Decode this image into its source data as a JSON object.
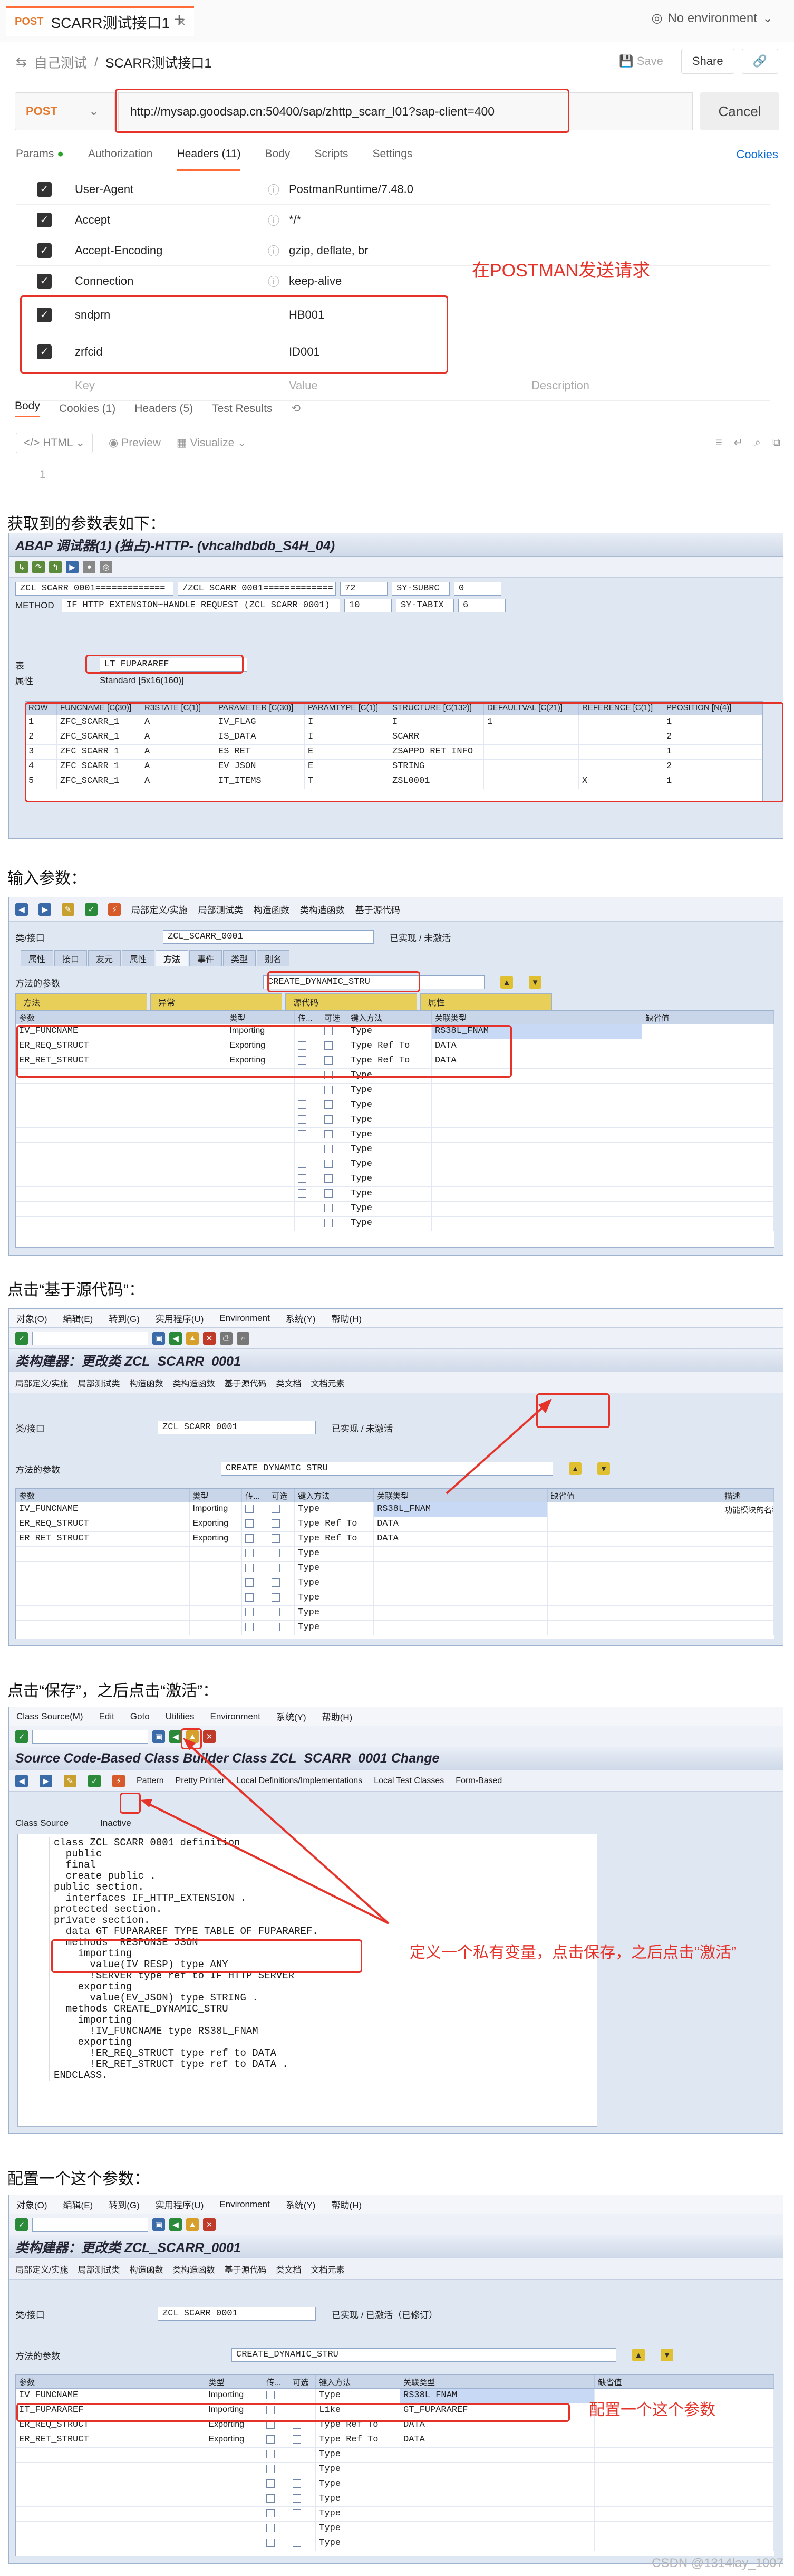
{
  "postman": {
    "tab_method": "POST",
    "tab_title": "SCARR测试接口1",
    "env_label": "No environment",
    "crumb_parent": "自己测试",
    "crumb_title": "SCARR测试接口1",
    "save_label": "Save",
    "share_label": "Share",
    "method": "POST",
    "url": "http://mysap.goodsap.cn:50400/sap/zhttp_scarr_l01?sap-client=400",
    "cancel_label": "Cancel",
    "req_tabs": [
      "Params",
      "Authorization",
      "Headers (11)",
      "Body",
      "Scripts",
      "Settings"
    ],
    "cookies_label": "Cookies",
    "headers": [
      {
        "key": "User-Agent",
        "value": "PostmanRuntime/7.48.0"
      },
      {
        "key": "Accept",
        "value": "*/*"
      },
      {
        "key": "Accept-Encoding",
        "value": "gzip, deflate, br"
      },
      {
        "key": "Connection",
        "value": "keep-alive"
      },
      {
        "key": "sndprn",
        "value": "HB001"
      },
      {
        "key": "zrfcid",
        "value": "ID001"
      }
    ],
    "placeholder": {
      "key": "Key",
      "value": "Value",
      "desc": "Description"
    },
    "annotation": "在POSTMAN发送请求",
    "resp_tabs": [
      "Body",
      "Cookies (1)",
      "Headers (5)",
      "Test Results"
    ],
    "resp_tools": [
      "HTML",
      "Preview",
      "Visualize"
    ],
    "line_number": "1"
  },
  "captions": {
    "c1": "获取到的参数表如下：",
    "c2": "输入参数：",
    "c3": "点击“基于源代码”：",
    "c4": "点击“保存”，之后点击“激活”：",
    "c5": "配置一个这个参数："
  },
  "debugger": {
    "title": "ABAP 调试器(1) (独占)-HTTP- (vhcalhdbdb_S4H_04)",
    "var1": "ZCL_SCARR_0001=============",
    "var2": "/ZCL_SCARR_0001=============",
    "line1": "72",
    "sysf1": "SY-SUBRC",
    "sysv1": "0",
    "method_label": "METHOD",
    "method_val": "IF_HTTP_EXTENSION~HANDLE_REQUEST (ZCL_SCARR_0001)",
    "line2": "10",
    "sysf2": "SY-TABIX",
    "sysv2": "6",
    "table_label": "表",
    "table_name": "LT_FUPARAREF",
    "type_label": "属性",
    "type_val": "Standard [5x16(160)]",
    "columns": [
      "ROW",
      "FUNCNAME [C(30)]",
      "R3STATE [C(1)]",
      "PARAMETER [C(30)]",
      "PARAMTYPE [C(1)]",
      "STRUCTURE [C(132)]",
      "DEFAULTVAL [C(21)]",
      "REFERENCE [C(1)]",
      "PPOSITION [N(4)]"
    ],
    "rows": [
      [
        "1",
        "ZFC_SCARR_1",
        "A",
        "IV_FLAG",
        "I",
        "I",
        "1",
        "",
        "1"
      ],
      [
        "2",
        "ZFC_SCARR_1",
        "A",
        "IS_DATA",
        "I",
        "SCARR",
        "",
        "",
        "2"
      ],
      [
        "3",
        "ZFC_SCARR_1",
        "A",
        "ES_RET",
        "E",
        "ZSAPPO_RET_INFO",
        "",
        "",
        "1"
      ],
      [
        "4",
        "ZFC_SCARR_1",
        "A",
        "EV_JSON",
        "E",
        "STRING",
        "",
        "",
        "2"
      ],
      [
        "5",
        "ZFC_SCARR_1",
        "A",
        "IT_ITEMS",
        "T",
        "ZSL0001",
        "",
        "X",
        "1"
      ]
    ]
  },
  "builder1": {
    "toolbar_items": [
      "局部定义/实施",
      "局部测试类",
      "构造函数",
      "类构造函数",
      "基于源代码"
    ],
    "class_label": "类/接口",
    "class_name": "ZCL_SCARR_0001",
    "class_status": "已实现 / 未激活",
    "tabs": [
      "属性",
      "接口",
      "友元",
      "属性",
      "方法",
      "事件",
      "类型",
      "别名"
    ],
    "method_label": "方法的参数",
    "method_name": "CREATE_DYNAMIC_STRU",
    "sub_tabs": [
      "方法",
      "异常",
      "源代码",
      "属性"
    ],
    "grid_head": [
      "参数",
      "类型",
      "传...",
      "可选",
      "键入方法",
      "关联类型",
      "缺省值"
    ],
    "params": [
      {
        "name": "IV_FUNCNAME",
        "kind": "Importing",
        "typing": "Type",
        "ref": "RS38L_FNAM"
      },
      {
        "name": "ER_REQ_STRUCT",
        "kind": "Exporting",
        "typing": "Type Ref To",
        "ref": "DATA"
      },
      {
        "name": "ER_RET_STRUCT",
        "kind": "Exporting",
        "typing": "Type Ref To",
        "ref": "DATA"
      }
    ],
    "empty_typing": "Type"
  },
  "builder2": {
    "menu": [
      "对象(O)",
      "编辑(E)",
      "转到(G)",
      "实用程序(U)",
      "Environment",
      "系统(Y)",
      "帮助(H)"
    ],
    "title": "类构建器：更改类 ZCL_SCARR_0001",
    "toolbar_items": [
      "局部定义/实施",
      "局部测试类",
      "构造函数",
      "类构造函数",
      "基于源代码",
      "类文档",
      "文档元素"
    ],
    "class_label": "类/接口",
    "class_name": "ZCL_SCARR_0001",
    "class_status": "已实现 / 未激活",
    "method_label": "方法的参数",
    "method_name": "CREATE_DYNAMIC_STRU",
    "grid_head": [
      "参数",
      "类型",
      "传...",
      "可选",
      "键入方法",
      "关联类型",
      "缺省值",
      "描述"
    ],
    "desc1": "功能模块的名称"
  },
  "source": {
    "menu": [
      "Class Source(M)",
      "Edit",
      "Goto",
      "Utilities",
      "Environment",
      "系统(Y)",
      "帮助(H)"
    ],
    "title": "Source Code-Based Class Builder Class ZCL_SCARR_0001 Change",
    "toolbar": [
      "Pattern",
      "Pretty Printer",
      "Local Definitions/Implementations",
      "Local Test Classes",
      "Form-Based"
    ],
    "class_source_label": "Class Source",
    "status": "Inactive",
    "lines": [
      "class ZCL_SCARR_0001 definition",
      "  public",
      "  final",
      "  create public .",
      "",
      "public section.",
      "",
      "  interfaces IF_HTTP_EXTENSION .",
      "protected section.",
      "private section.",
      "  data GT_FUPARAREF TYPE TABLE OF FUPARAREF.",
      "",
      "  methods _RESPONSE_JSON",
      "    importing",
      "      value(IV_RESP) type ANY",
      "      !SERVER type ref to IF_HTTP_SERVER",
      "    exporting",
      "      value(EV_JSON) type STRING .",
      "  methods CREATE_DYNAMIC_STRU",
      "    importing",
      "      !IV_FUNCNAME type RS38L_FNAM",
      "    exporting",
      "      !ER_REQ_STRUCT type ref to DATA",
      "      !ER_RET_STRUCT type ref to DATA .",
      "ENDCLASS."
    ],
    "annotation": "定义一个私有变量，点击保存，之后点击“激活”"
  },
  "builder3": {
    "menu": [
      "对象(O)",
      "编辑(E)",
      "转到(G)",
      "实用程序(U)",
      "Environment",
      "系统(Y)",
      "帮助(H)"
    ],
    "title": "类构建器：更改类 ZCL_SCARR_0001",
    "toolbar_items": [
      "局部定义/实施",
      "局部测试类",
      "构造函数",
      "类构造函数",
      "基于源代码",
      "类文档",
      "文档元素"
    ],
    "class_label": "类/接口",
    "class_name": "ZCL_SCARR_0001",
    "class_status": "已实现 / 已激活（已修订）",
    "method_label": "方法的参数",
    "method_name": "CREATE_DYNAMIC_STRU",
    "grid_head": [
      "参数",
      "类型",
      "传...",
      "可选",
      "键入方法",
      "关联类型",
      "缺省值"
    ],
    "params": [
      {
        "name": "IV_FUNCNAME",
        "kind": "Importing",
        "typing": "Type",
        "ref": "RS38L_FNAM"
      },
      {
        "name": "IT_FUPARAREF",
        "kind": "Importing",
        "typing": "Like",
        "ref": "GT_FUPARAREF"
      },
      {
        "name": "ER_REQ_STRUCT",
        "kind": "Exporting",
        "typing": "Type Ref To",
        "ref": "DATA"
      },
      {
        "name": "ER_RET_STRUCT",
        "kind": "Exporting",
        "typing": "Type Ref To",
        "ref": "DATA"
      }
    ],
    "annotation": "配置一个这个参数"
  },
  "watermark": "CSDN @1314lay_1007",
  "colors": {
    "accent": "#ff6c37",
    "annot": "#e5332a",
    "sap_bg": "#dfe7f2"
  }
}
